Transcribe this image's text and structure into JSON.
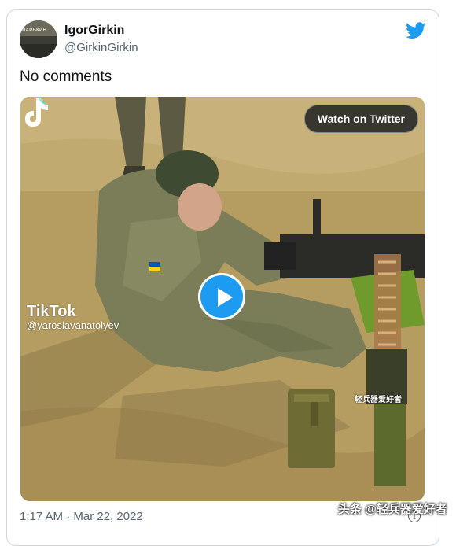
{
  "tweet": {
    "display_name": "IgorGirkin",
    "handle": "@GirkinGirkin",
    "text": "No comments",
    "timestamp": "1:17 AM · Mar 22, 2022",
    "avatar_caption": "ЛАРЬКИН"
  },
  "media": {
    "watch_label": "Watch on Twitter",
    "tiktok_label": "TikTok",
    "tiktok_user": "@yaroslavanatolyev",
    "video_watermark": "轻兵器爱好者"
  },
  "overlay": {
    "watermark": "头条 @轻兵器爱好者"
  },
  "icons": {
    "brand": "twitter-bird-icon",
    "play": "play-icon",
    "info": "info-icon",
    "tiktok": "tiktok-logo-icon"
  },
  "colors": {
    "twitter_blue": "#1d9bf0",
    "text_primary": "#0f1419",
    "text_secondary": "#536471"
  }
}
